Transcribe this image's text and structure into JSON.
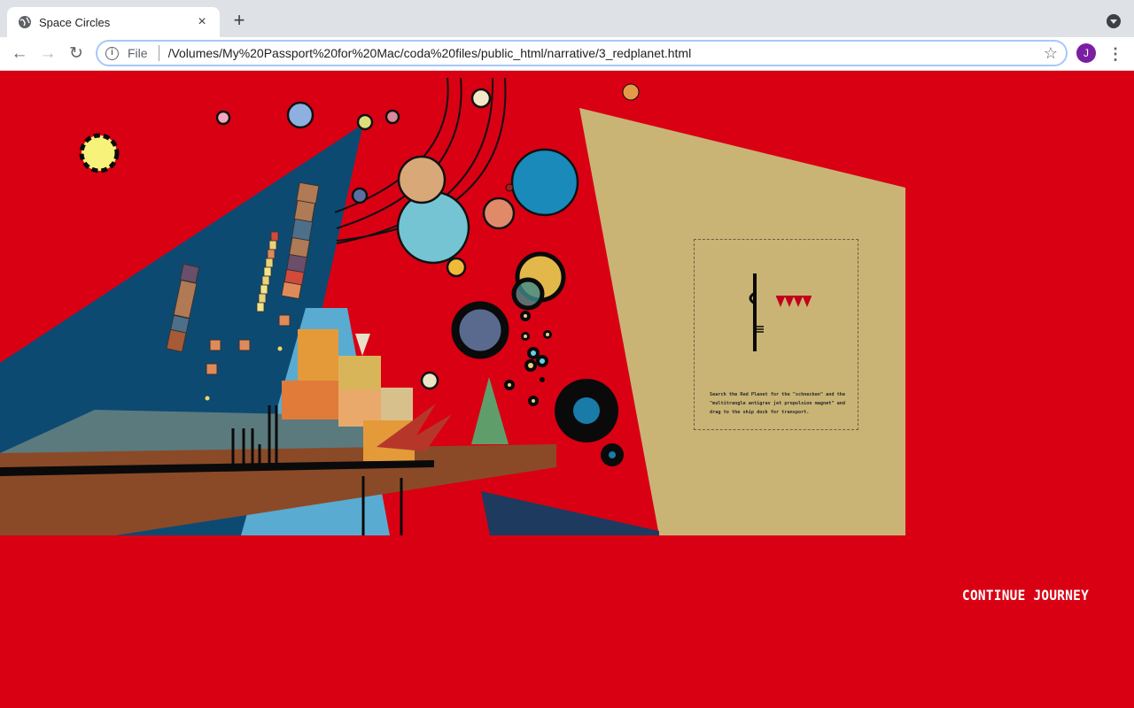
{
  "tab": {
    "title": "Space Circles",
    "close_label": "×",
    "favicon": "globe-icon"
  },
  "tabbar": {
    "new_tab_label": "+",
    "menu_icon": "chevron-down-icon"
  },
  "toolbar": {
    "back_icon": "arrow-left-icon",
    "forward_icon": "arrow-right-icon",
    "reload_icon": "reload-icon",
    "info_icon": "info-icon",
    "scheme_label": "File",
    "url": "/Volumes/My%20Passport%20for%20Mac/coda%20files/public_html/narrative/3_redplanet.html",
    "bookmark_icon": "star-icon",
    "profile_initial": "J",
    "menu_icon": "kebab-icon"
  },
  "page": {
    "background_color": "#d90013",
    "instructions": "Search the Red Planet for the \"schnecken\" and the \"multitrangle antigrav jet propulsion magnet\" and drag to the ship dock for transport.",
    "continue_label": "CONTINUE JOURNEY"
  },
  "colors": {
    "navy": "#0d4a72",
    "tan": "#c9b475",
    "brown": "#8a4a28",
    "sky": "#5aabd1",
    "red": "#d90013"
  }
}
